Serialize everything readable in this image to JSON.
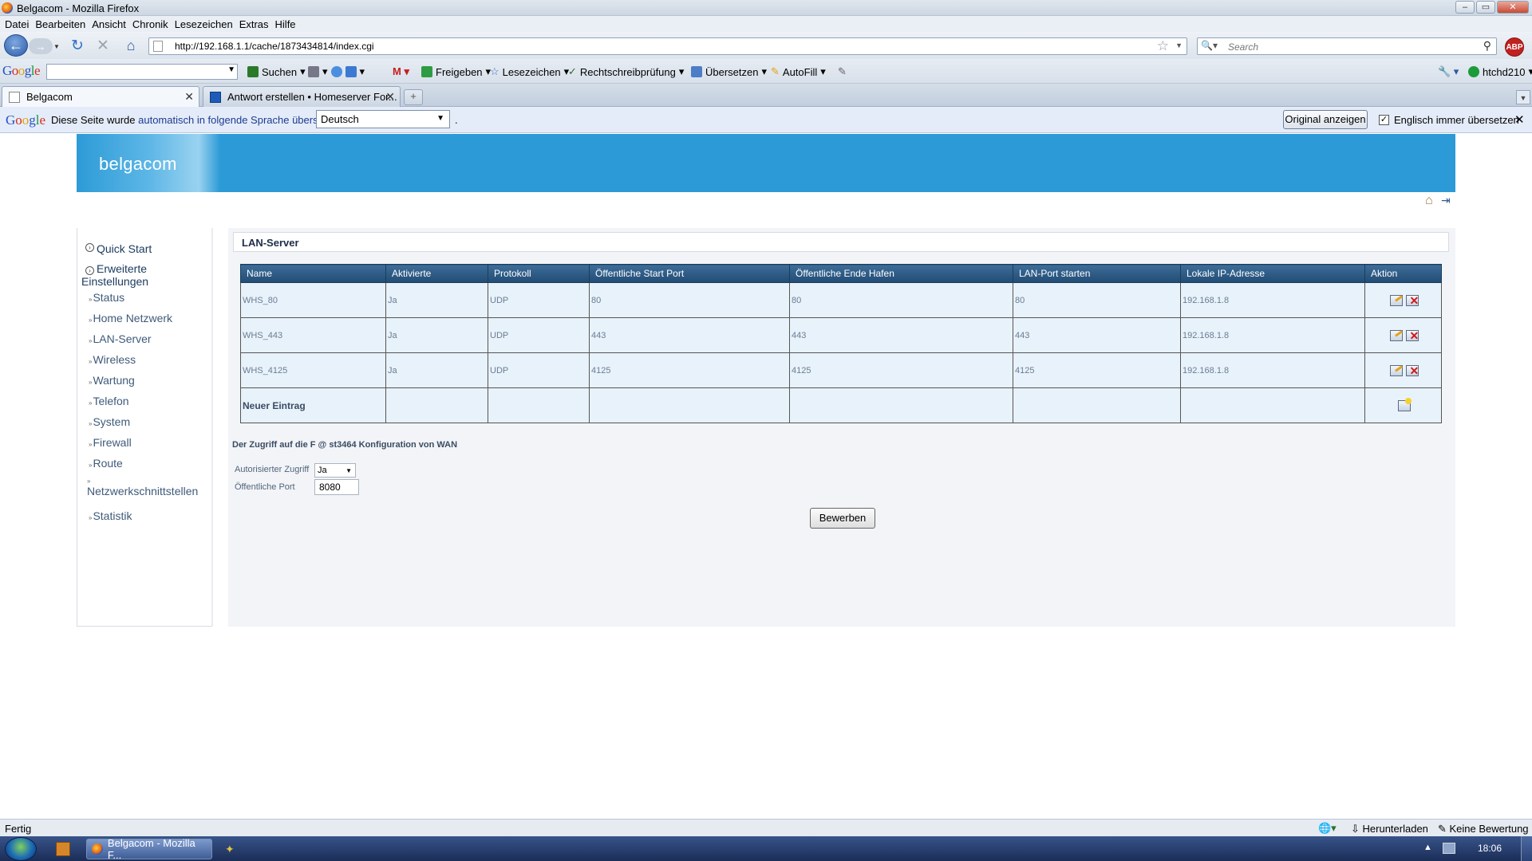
{
  "window": {
    "title": "Belgacom - Mozilla Firefox",
    "controls": [
      "–",
      "▭",
      "✕"
    ]
  },
  "menu": [
    "Datei",
    "Bearbeiten",
    "Ansicht",
    "Chronik",
    "Lesezeichen",
    "Extras",
    "Hilfe"
  ],
  "nav": {
    "url": "http://192.168.1.1/cache/1873434814/index.cgi",
    "search_placeholder": "Search",
    "abp_label": "ABP"
  },
  "google_toolbar": {
    "search_label": "Suchen",
    "share_label": "Freigeben",
    "bookmarks_label": "Lesezeichen",
    "spellcheck_label": "Rechtschreibprüfung",
    "translate_label": "Übersetzen",
    "autofill_label": "AutoFill",
    "user_label": "htchd210"
  },
  "tabs": [
    {
      "label": "Belgacom",
      "active": true
    },
    {
      "label": "Antwort erstellen • Homeserver For...",
      "active": false
    }
  ],
  "translate_bar": {
    "msg_prefix": "Diese Seite wurde",
    "msg_link": "automatisch in folgende Sprache übersetzt:",
    "language": "Deutsch",
    "dot": ".",
    "show_original": "Original anzeigen",
    "always_label": "Englisch immer übersetzen",
    "always_checked": true
  },
  "brand": {
    "logo": "belgacom",
    "color": "#2b9ad6"
  },
  "sidebar": {
    "main_items": [
      "Quick Start",
      "Erweiterte Einstellungen"
    ],
    "sub_items": [
      "Status",
      "Home Netzwerk",
      "LAN-Server",
      "Wireless",
      "Wartung",
      "Telefon",
      "System",
      "Firewall",
      "Route",
      "Netzwerkschnittstellen",
      "Statistik"
    ]
  },
  "section": {
    "title": "LAN-Server"
  },
  "table": {
    "headers": [
      "Name",
      "Aktivierte",
      "Protokoll",
      "Öffentliche Start Port",
      "Öffentliche Ende Hafen",
      "LAN-Port starten",
      "Lokale IP-Adresse",
      "Aktion"
    ],
    "rows": [
      [
        "WHS_80",
        "Ja",
        "UDP",
        "80",
        "80",
        "80",
        "192.168.1.8"
      ],
      [
        "WHS_443",
        "Ja",
        "UDP",
        "443",
        "443",
        "443",
        "192.168.1.8"
      ],
      [
        "WHS_4125",
        "Ja",
        "UDP",
        "4125",
        "4125",
        "4125",
        "192.168.1.8"
      ]
    ],
    "new_entry_label": "Neuer Eintrag"
  },
  "wan": {
    "note": "Der Zugriff auf die F @ st3464 Konfiguration von WAN",
    "auth_label": "Autorisierter Zugriff",
    "auth_value": "Ja",
    "port_label": "Öffentliche Port",
    "port_value": "8080",
    "apply_label": "Bewerben"
  },
  "status": {
    "left": "Fertig",
    "download": "Herunterladen",
    "rating": "Keine Bewertung"
  },
  "taskbar": {
    "task_label": "Belgacom - Mozilla F...",
    "clock": "18:06"
  }
}
